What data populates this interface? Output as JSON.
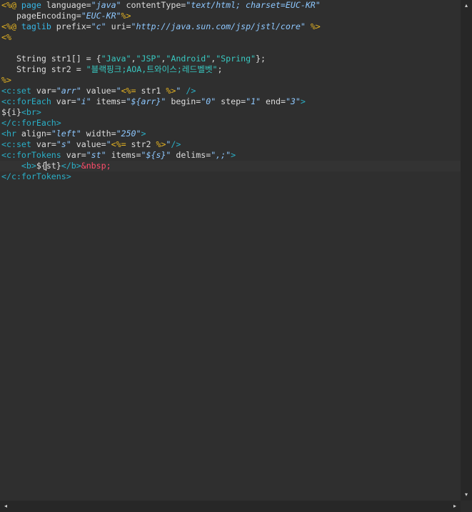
{
  "editor": {
    "lines": [
      [
        {
          "t": "<%@ ",
          "c": "delim"
        },
        {
          "t": "page ",
          "c": "kw"
        },
        {
          "t": "language=",
          "c": "attr"
        },
        {
          "t": "\"java\"",
          "c": "str"
        },
        {
          "t": " contentType=",
          "c": "attr"
        },
        {
          "t": "\"text/html; charset=EUC-KR\"",
          "c": "str"
        }
      ],
      [
        {
          "t": "   pageEncoding=",
          "c": "attr"
        },
        {
          "t": "\"EUC-KR\"",
          "c": "str"
        },
        {
          "t": "%>",
          "c": "delim"
        }
      ],
      [
        {
          "t": "<%@ ",
          "c": "delim"
        },
        {
          "t": "taglib ",
          "c": "kw"
        },
        {
          "t": "prefix=",
          "c": "attr"
        },
        {
          "t": "\"c\"",
          "c": "str"
        },
        {
          "t": " uri=",
          "c": "attr"
        },
        {
          "t": "\"http://java.sun.com/jsp/jstl/core\"",
          "c": "str"
        },
        {
          "t": " %>",
          "c": "delim"
        }
      ],
      [
        {
          "t": "<%",
          "c": "delim"
        }
      ],
      [],
      [
        {
          "t": "   String str1[] = {",
          "c": "text"
        },
        {
          "t": "\"Java\"",
          "c": "jstr"
        },
        {
          "t": ",",
          "c": "text"
        },
        {
          "t": "\"JSP\"",
          "c": "jstr"
        },
        {
          "t": ",",
          "c": "text"
        },
        {
          "t": "\"Android\"",
          "c": "jstr"
        },
        {
          "t": ",",
          "c": "text"
        },
        {
          "t": "\"Spring\"",
          "c": "jstr"
        },
        {
          "t": "};",
          "c": "text"
        }
      ],
      [
        {
          "t": "   String str2 = ",
          "c": "text"
        },
        {
          "t": "\"블랙핑크;AOA,트와이스;레드벨벳\"",
          "c": "jstr"
        },
        {
          "t": ";",
          "c": "text"
        }
      ],
      [
        {
          "t": "%>",
          "c": "delim"
        }
      ],
      [
        {
          "t": "<c:set ",
          "c": "tag"
        },
        {
          "t": "var=",
          "c": "attr"
        },
        {
          "t": "\"arr\"",
          "c": "str"
        },
        {
          "t": " value=",
          "c": "attr"
        },
        {
          "t": "\"",
          "c": "str"
        },
        {
          "t": "<%=",
          "c": "delim"
        },
        {
          "t": " str1 ",
          "c": "text"
        },
        {
          "t": "%>",
          "c": "delim"
        },
        {
          "t": "\"",
          "c": "str"
        },
        {
          "t": " />",
          "c": "tag"
        }
      ],
      [
        {
          "t": "<c:forEach ",
          "c": "tag"
        },
        {
          "t": "var=",
          "c": "attr"
        },
        {
          "t": "\"i\"",
          "c": "str"
        },
        {
          "t": " items=",
          "c": "attr"
        },
        {
          "t": "\"${arr}\"",
          "c": "str"
        },
        {
          "t": " begin=",
          "c": "attr"
        },
        {
          "t": "\"0\"",
          "c": "str"
        },
        {
          "t": " step=",
          "c": "attr"
        },
        {
          "t": "\"1\"",
          "c": "str"
        },
        {
          "t": " end=",
          "c": "attr"
        },
        {
          "t": "\"3\"",
          "c": "str"
        },
        {
          "t": ">",
          "c": "tag"
        }
      ],
      [
        {
          "t": "${i}",
          "c": "text"
        },
        {
          "t": "<br>",
          "c": "tag"
        }
      ],
      [
        {
          "t": "</c:forEach>",
          "c": "tag"
        }
      ],
      [
        {
          "t": "<hr ",
          "c": "tag"
        },
        {
          "t": "align=",
          "c": "attr"
        },
        {
          "t": "\"left\"",
          "c": "str"
        },
        {
          "t": " width=",
          "c": "attr"
        },
        {
          "t": "\"250\"",
          "c": "str"
        },
        {
          "t": ">",
          "c": "tag"
        }
      ],
      [
        {
          "t": "<c:set ",
          "c": "tag"
        },
        {
          "t": "var=",
          "c": "attr"
        },
        {
          "t": "\"s\"",
          "c": "str"
        },
        {
          "t": " value=",
          "c": "attr"
        },
        {
          "t": "\"",
          "c": "str"
        },
        {
          "t": "<%=",
          "c": "delim"
        },
        {
          "t": " str2 ",
          "c": "text"
        },
        {
          "t": "%>",
          "c": "delim"
        },
        {
          "t": "\"",
          "c": "str"
        },
        {
          "t": "/>",
          "c": "tag"
        }
      ],
      [
        {
          "t": "<c:forTokens ",
          "c": "tag"
        },
        {
          "t": "var=",
          "c": "attr"
        },
        {
          "t": "\"st\"",
          "c": "str"
        },
        {
          "t": " items=",
          "c": "attr"
        },
        {
          "t": "\"${s}\"",
          "c": "str"
        },
        {
          "t": " delims=",
          "c": "attr"
        },
        {
          "t": "\",;\"",
          "c": "str"
        },
        {
          "t": ">",
          "c": "tag"
        }
      ],
      [
        {
          "t": "    ",
          "c": "text"
        },
        {
          "t": "<b>",
          "c": "tag"
        },
        {
          "t": "${",
          "c": "text"
        },
        {
          "t": "|",
          "c": "cursor"
        },
        {
          "t": "st}",
          "c": "text"
        },
        {
          "t": "</b>",
          "c": "tag"
        },
        {
          "t": "&nbsp;",
          "c": "ent"
        }
      ],
      [
        {
          "t": "</c:forTokens>",
          "c": "tag"
        }
      ]
    ],
    "current_line": 15
  },
  "scrollbars": {
    "horizontal": {
      "left_arrow": "◂",
      "right_arrow": "▸"
    },
    "vertical": {
      "up_arrow": "▴",
      "down_arrow": "▾"
    }
  }
}
